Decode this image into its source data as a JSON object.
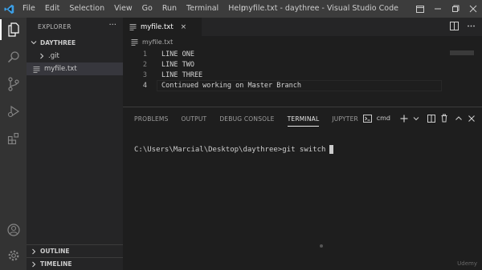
{
  "window": {
    "title": "myfile.txt - daythree - Visual Studio Code",
    "menu": [
      "File",
      "Edit",
      "Selection",
      "View",
      "Go",
      "Run",
      "Terminal",
      "Help"
    ]
  },
  "activity_bar": {
    "items": [
      "files-icon",
      "search-icon",
      "source-control-icon",
      "run-debug-icon",
      "extensions-icon"
    ],
    "bottom": [
      "account-icon",
      "settings-gear-icon"
    ]
  },
  "sidebar": {
    "header": "EXPLORER",
    "more": "···",
    "folder": "DAYTHREE",
    "items": [
      {
        "label": ".git",
        "type": "folder"
      },
      {
        "label": "myfile.txt",
        "type": "file",
        "selected": true
      }
    ],
    "outline": "OUTLINE",
    "timeline": "TIMELINE"
  },
  "editor": {
    "tab": "myfile.txt",
    "tab_close": "×",
    "breadcrumb": "myfile.txt",
    "lines": [
      {
        "num": "1",
        "text": "LINE ONE"
      },
      {
        "num": "2",
        "text": "LINE TWO"
      },
      {
        "num": "3",
        "text": "LINE THREE"
      },
      {
        "num": "4",
        "text": "Continued working on Master Branch"
      }
    ],
    "current_line": 4
  },
  "panel": {
    "tabs": [
      "PROBLEMS",
      "OUTPUT",
      "DEBUG CONSOLE",
      "TERMINAL",
      "JUPYTER"
    ],
    "active_tab": "TERMINAL",
    "shell": "cmd",
    "terminal_line": "C:\\Users\\Marcial\\Desktop\\daythree>git switch"
  },
  "watermark": "Udemy",
  "colors": {
    "titlebar": "#3c3c3c",
    "activitybar": "#333333",
    "sidebar": "#252526",
    "editor": "#1e1e1e",
    "vscode_blue": "#3c9ee4"
  }
}
